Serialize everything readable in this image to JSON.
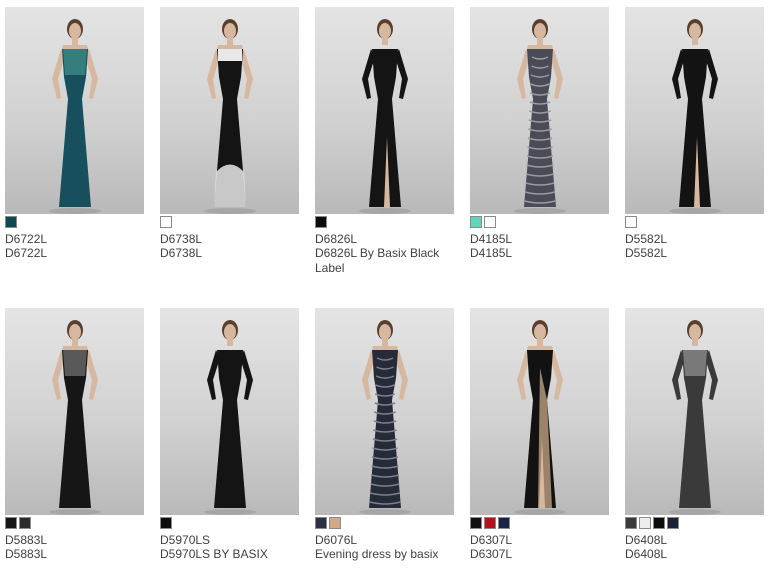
{
  "products": [
    {
      "code": "D6722L",
      "name": "D6722L",
      "swatches": [
        "#0d4a52"
      ],
      "dress": "#184f5c",
      "accent": "#3f8a86",
      "style": "sleeveless-lace"
    },
    {
      "code": "D6738L",
      "name": "D6738L",
      "swatches": [
        "#ffffff"
      ],
      "dress": "#141414",
      "accent": "#e8e8e8",
      "style": "strapless-embroidered"
    },
    {
      "code": "D6826L",
      "name": "D6826L By Basix Black Label",
      "swatches": [
        "#0c0c0c"
      ],
      "dress": "#141414",
      "accent": "#2c2c2c",
      "style": "longsleeve-slit"
    },
    {
      "code": "D4185L",
      "name": "D4185L",
      "swatches": [
        "#62d6bd",
        "#ffffff"
      ],
      "dress": "#4b4b56",
      "accent": "#9a9aa6",
      "style": "sequin-vneck"
    },
    {
      "code": "D5582L",
      "name": "D5582L",
      "swatches": [
        "#ffffff"
      ],
      "dress": "#131313",
      "accent": "#262626",
      "style": "longsleeve-slit"
    },
    {
      "code": "D5883L",
      "name": "D5883L",
      "swatches": [
        "#151515",
        "#2b2b2b"
      ],
      "dress": "#161616",
      "accent": "#6a6a6a",
      "style": "cap-beaded"
    },
    {
      "code": "D5970LS",
      "name": "D5970LS BY BASIX",
      "swatches": [
        "#0d0d0d"
      ],
      "dress": "#141414",
      "accent": "#3a3a3a",
      "style": "longsleeve-sheer"
    },
    {
      "code": "D6076L",
      "name": "Evening dress by basix",
      "swatches": [
        "#2c3040",
        "#d2a88a"
      ],
      "dress": "#272b38",
      "accent": "#7b8092",
      "style": "strap-sequin"
    },
    {
      "code": "D6307L",
      "name": "D6307L",
      "swatches": [
        "#111111",
        "#b6121c",
        "#1a2347"
      ],
      "dress": "#121212",
      "accent": "#c9a98a",
      "style": "asym-slit"
    },
    {
      "code": "D6408L",
      "name": "D6408L",
      "swatches": [
        "#3a3a3a",
        "#eeeeee",
        "#0c0c0c",
        "#1c2136"
      ],
      "dress": "#3a3a3a",
      "accent": "#8a8a8a",
      "style": "longsleeve-beaded"
    }
  ]
}
